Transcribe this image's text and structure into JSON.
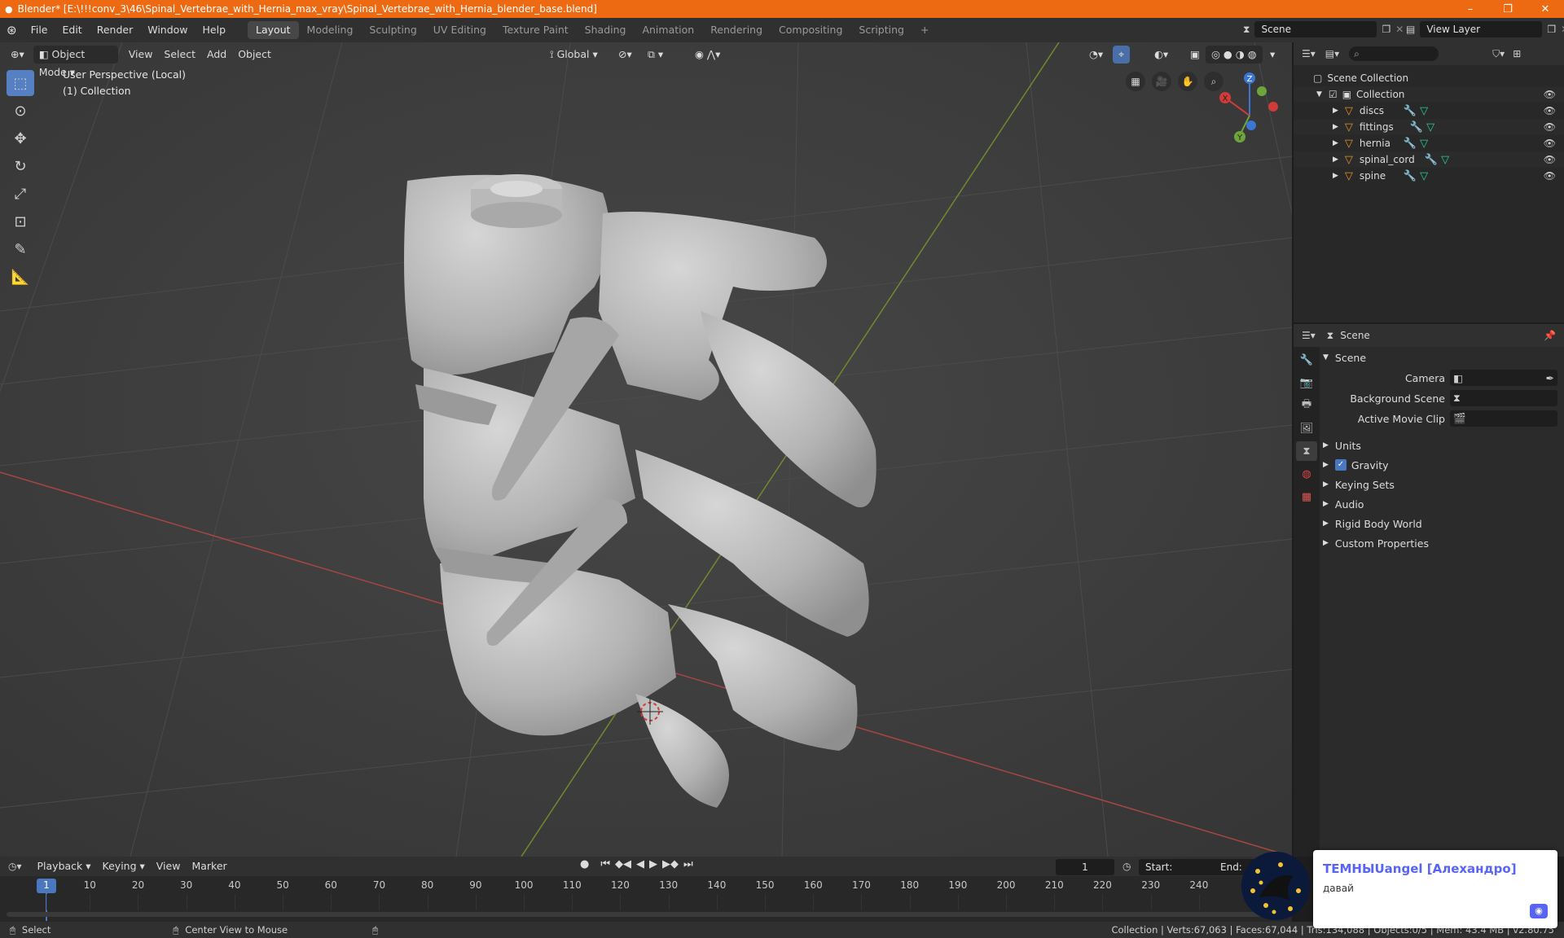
{
  "titlebar": {
    "title": "Blender* [E:\\!!!conv_3\\46\\Spinal_Vertebrae_with_Hernia_max_vray\\Spinal_Vertebrae_with_Hernia_blender_base.blend]",
    "minimize": "–",
    "restore": "❐",
    "close": "✕",
    "bg_color": "#ee6a12"
  },
  "menu": [
    "File",
    "Edit",
    "Render",
    "Window",
    "Help"
  ],
  "workspaces": [
    "Layout",
    "Modeling",
    "Sculpting",
    "UV Editing",
    "Texture Paint",
    "Shading",
    "Animation",
    "Rendering",
    "Compositing",
    "Scripting"
  ],
  "active_workspace": "Layout",
  "add_workspace": "+",
  "scene_field": "Scene",
  "view_layer_field": "View Layer",
  "viewport": {
    "mode": "Object Mode",
    "menus": [
      "View",
      "Select",
      "Add",
      "Object"
    ],
    "orientation": "Global",
    "perspective_label": "User Perspective (Local)",
    "collection_label": "(1) Collection",
    "gizmo": {
      "x": "X",
      "y": "Y",
      "z": "Z"
    }
  },
  "outliner": {
    "root": "Scene Collection",
    "collection": "Collection",
    "objects": [
      "discs",
      "fittings",
      "hernia",
      "spinal_cord",
      "spine"
    ]
  },
  "properties": {
    "context": "Scene",
    "panel_title": "Scene",
    "fields": [
      {
        "label": "Camera",
        "value": ""
      },
      {
        "label": "Background Scene",
        "value": ""
      },
      {
        "label": "Active Movie Clip",
        "value": ""
      }
    ],
    "sections": [
      "Units",
      "Gravity",
      "Keying Sets",
      "Audio",
      "Rigid Body World",
      "Custom Properties"
    ],
    "gravity_checked": true
  },
  "timeline": {
    "menus": [
      "Playback",
      "Keying",
      "View",
      "Marker"
    ],
    "current_frame": "1",
    "start_label": "Start:",
    "start_value": "1",
    "end_label": "End:",
    "ticks": [
      "1",
      "10",
      "20",
      "30",
      "40",
      "50",
      "60",
      "70",
      "80",
      "90",
      "100",
      "110",
      "120",
      "130",
      "140",
      "150",
      "160",
      "170",
      "180",
      "190",
      "200",
      "210",
      "220",
      "230",
      "240"
    ]
  },
  "statusbar": {
    "select": "Select",
    "center": "Center View to Mouse",
    "stats": "Collection | Verts:67,063 | Faces:67,044 | Tris:134,088 | Objects:0/5 | Mem: 43.4 MB | v2.80.75"
  },
  "notification": {
    "name": "ТЕМНЫUangel [Алехандро]",
    "message": "давай"
  }
}
